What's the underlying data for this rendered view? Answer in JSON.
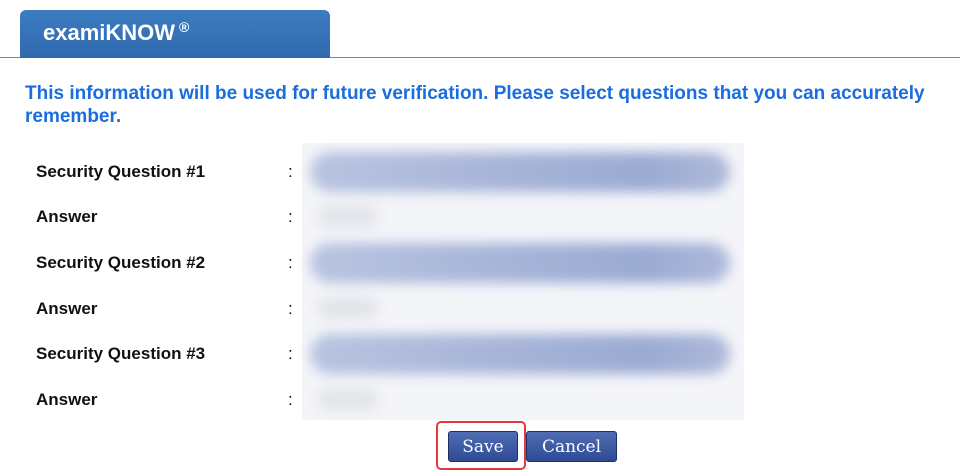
{
  "header": {
    "brand": "examiKNOW",
    "registered_mark": "®"
  },
  "instruction": "This information will be used for future verification. Please select questions that you can accurately remember.",
  "form": {
    "colon": ":",
    "rows": [
      {
        "label": "Security Question #1"
      },
      {
        "label": "Answer"
      },
      {
        "label": "Security Question #2"
      },
      {
        "label": "Answer"
      },
      {
        "label": "Security Question #3"
      },
      {
        "label": "Answer"
      }
    ]
  },
  "buttons": {
    "save": "Save",
    "cancel": "Cancel"
  },
  "colors": {
    "brand_blue": "#2f69ad",
    "instruction_blue": "#1a6ddd",
    "button_blue": "#2f4a94",
    "highlight_red": "#e0393e"
  }
}
